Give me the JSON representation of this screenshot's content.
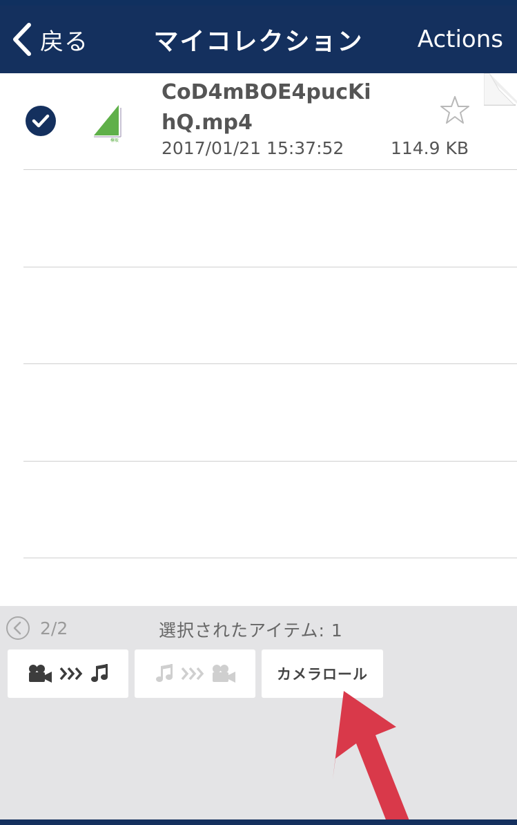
{
  "colors": {
    "navbar": "#14305e",
    "accent_check": "#14305e",
    "panel": "#e4e4e6",
    "annotation_arrow": "#d9394a"
  },
  "navbar": {
    "back_label": "戻る",
    "title": "マイコレクション",
    "actions_label": "Actions"
  },
  "file": {
    "name": "CoD4mBOE4pucKihQ.mp4",
    "date": "2017/01/21 15:37:52",
    "size": "114.9 KB",
    "selected": true,
    "starred": false,
    "thumbnail_icon": "green-triangle-logo-icon",
    "thumbnail_caption": "欅坂"
  },
  "bottom": {
    "pager": "2/2",
    "selected_items": "選択されたアイテム: 1",
    "buttons": {
      "video_to_audio": "video-to-audio",
      "audio_to_video": "audio-to-video",
      "camera_roll": "カメラロール"
    },
    "audio_to_video_enabled": false
  }
}
